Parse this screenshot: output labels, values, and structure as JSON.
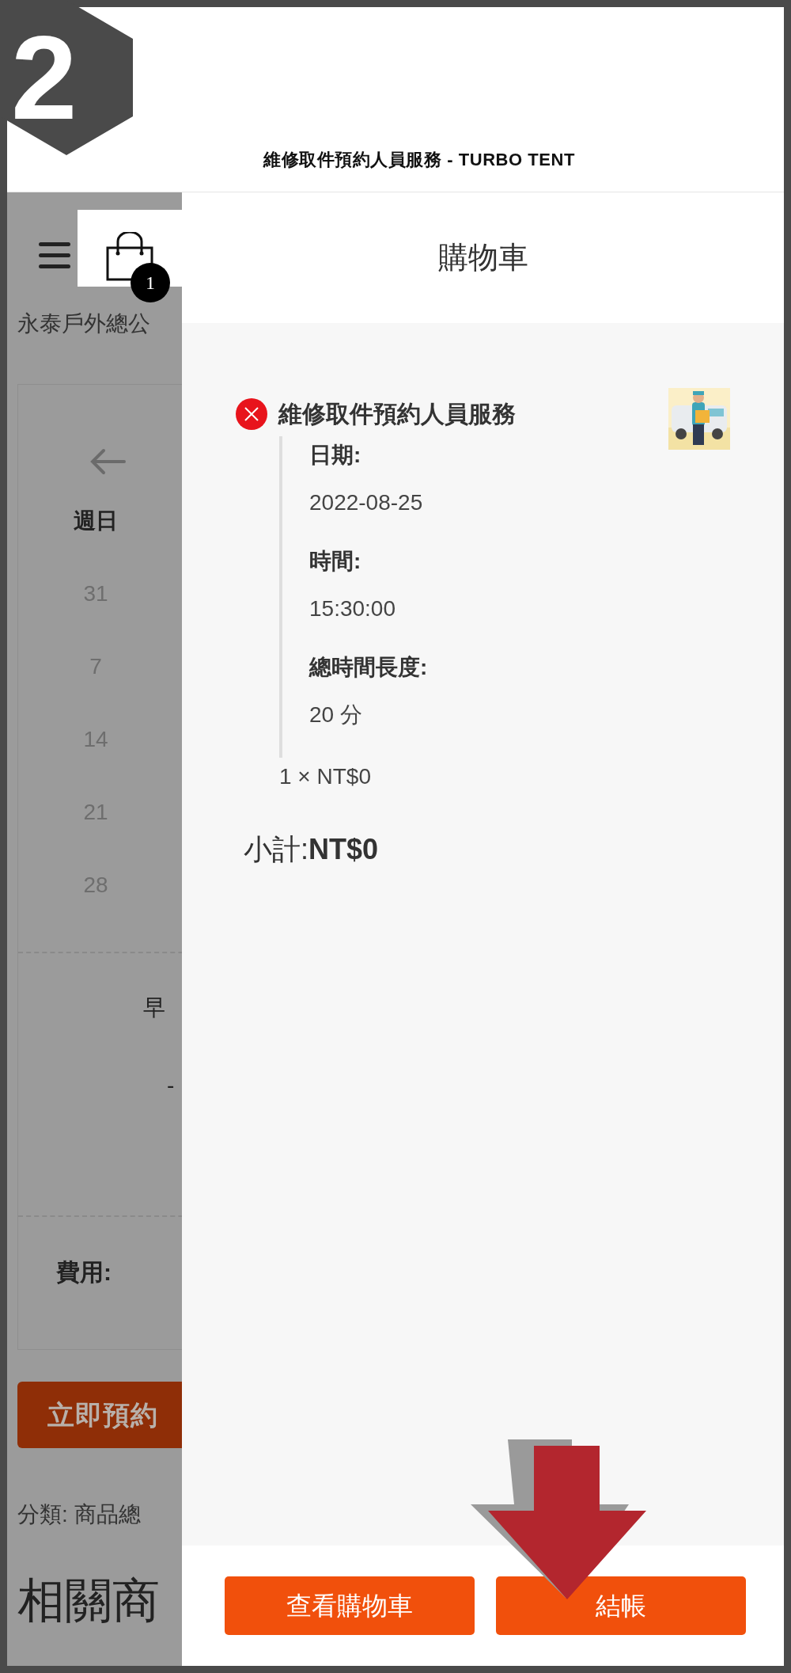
{
  "step_badge": "2",
  "header": {
    "title": "維修取件預約人員服務 - TURBO TENT"
  },
  "background_page": {
    "location": "永泰戶外總公",
    "calendar": {
      "weekday": "週日",
      "days": [
        "31",
        "7",
        "14",
        "21",
        "28"
      ],
      "period": "早",
      "dash": "-",
      "fee_label": "費用:"
    },
    "book_button": "立即預約",
    "category": "分類: 商品總",
    "related_heading": "相關商"
  },
  "cart": {
    "count": "1",
    "title": "購物車",
    "items": [
      {
        "name": "維修取件預約人員服務",
        "details": [
          {
            "label": "日期:",
            "value": "2022-08-25"
          },
          {
            "label": "時間:",
            "value": "15:30:00"
          },
          {
            "label": "總時間長度:",
            "value": "20 分"
          }
        ],
        "quantity_price": "1 × NT$0"
      }
    ],
    "subtotal_label": "小計:",
    "subtotal": "NT$0",
    "buttons": [
      "查看購物車",
      "結帳"
    ]
  }
}
